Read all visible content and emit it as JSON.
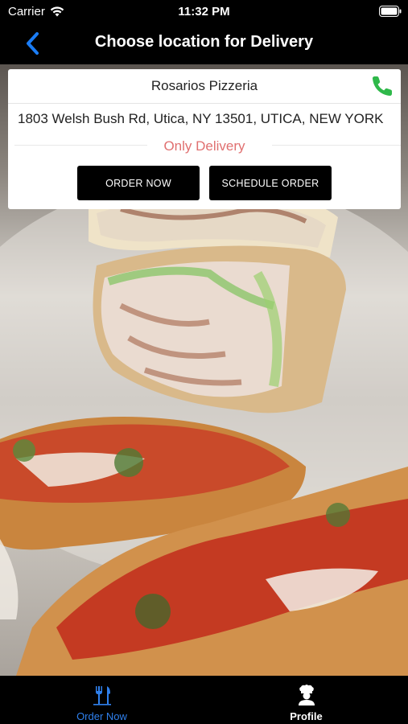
{
  "status_bar": {
    "carrier": "Carrier",
    "time": "11:32 PM",
    "wifi_icon": "wifi-icon",
    "battery_icon": "battery-icon"
  },
  "nav": {
    "title": "Choose location for Delivery",
    "back_icon": "chevron-left-icon",
    "accent_color": "#1a7cf5"
  },
  "location": {
    "name": "Rosarios Pizzeria",
    "address": "1803 Welsh Bush Rd, Utica, NY 13501, UTICA, NEW YORK",
    "mode": "Only Delivery",
    "mode_color": "#e07070",
    "phone_icon": "phone-icon",
    "phone_color": "#2fb84a",
    "buttons": {
      "order_now": "ORDER NOW",
      "schedule_order": "SCHEDULE ORDER"
    }
  },
  "background": {
    "image": "food-photo"
  },
  "tab_bar": {
    "items": [
      {
        "label": "Order Now",
        "icon": "fork-knife-icon",
        "active": true,
        "color": "#2f80ed"
      },
      {
        "label": "Profile",
        "icon": "chef-avatar-icon",
        "active": false,
        "color": "#ffffff"
      }
    ]
  }
}
